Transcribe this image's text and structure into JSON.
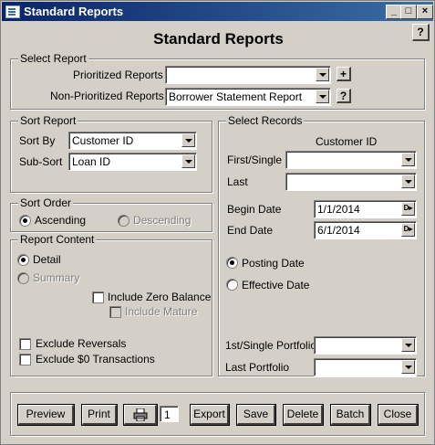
{
  "window": {
    "title": "Standard Reports",
    "min_glyph": "_",
    "max_glyph": "□",
    "close_glyph": "×"
  },
  "heading": "Standard Reports",
  "help_glyph": "?",
  "select_report": {
    "legend": "Select Report",
    "prioritized_label": "Prioritized Reports",
    "prioritized_value": "",
    "add_glyph": "+",
    "non_prioritized_label": "Non-Prioritized Reports",
    "non_prioritized_value": "Borrower Statement Report",
    "help_glyph": "?"
  },
  "sort_report": {
    "legend": "Sort Report",
    "sort_by_label": "Sort By",
    "sort_by_value": "Customer ID",
    "sub_sort_label": "Sub-Sort",
    "sub_sort_value": "Loan ID"
  },
  "sort_order": {
    "legend": "Sort Order",
    "ascending": "Ascending",
    "descending": "Descending",
    "selected": "Ascending"
  },
  "report_content": {
    "legend": "Report Content",
    "detail": "Detail",
    "summary": "Summary",
    "selected": "Detail",
    "include_zero_balance": "Include Zero Balance",
    "include_mature": "Include Mature",
    "exclude_reversals": "Exclude Reversals",
    "exclude_zero_transactions": "Exclude $0 Transactions"
  },
  "select_records": {
    "legend": "Select Records",
    "column_header": "Customer ID",
    "first_single_label": "First/Single",
    "first_single_value": "",
    "last_label": "Last",
    "last_value": "",
    "begin_date_label": "Begin Date",
    "begin_date_value": "1/1/2014",
    "end_date_label": "End Date",
    "end_date_value": "6/1/2014",
    "date_btn_glyph": "D▸",
    "posting_date": "Posting Date",
    "effective_date": "Effective Date",
    "date_type_selected": "Posting Date",
    "first_portfolio_label": "1st/Single Portfolio",
    "first_portfolio_value": "",
    "last_portfolio_label": "Last Portfolio",
    "last_portfolio_value": ""
  },
  "footer": {
    "preview": "Preview",
    "print": "Print",
    "printer_icon": "printer-icon",
    "copies": "1",
    "export": "Export",
    "save": "Save",
    "delete": "Delete",
    "batch": "Batch",
    "close": "Close"
  }
}
